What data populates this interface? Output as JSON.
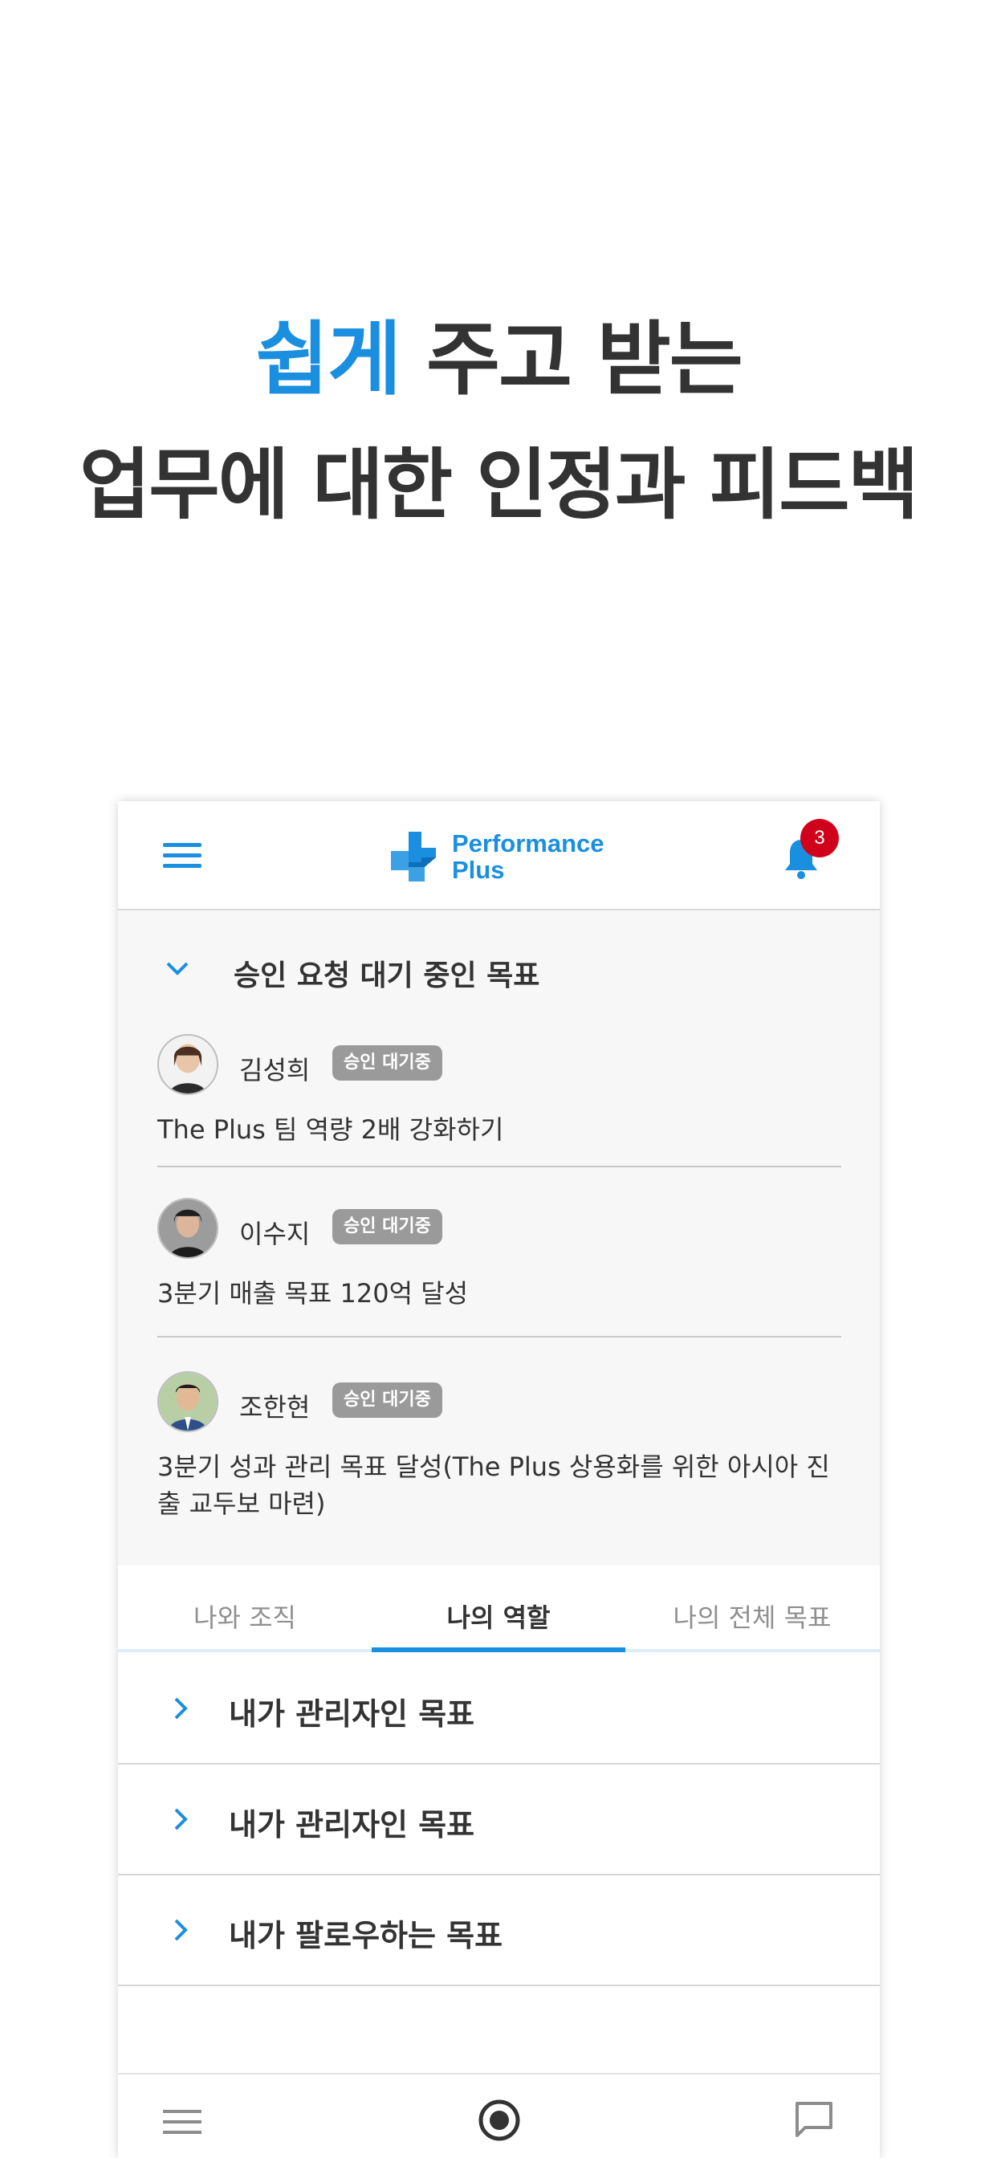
{
  "headline": {
    "line1_accent": "쉽게",
    "line1_rest": " 주고 받는",
    "line2": "업무에 대한 인정과 피드백"
  },
  "colors": {
    "accent": "#1a8fe0",
    "text": "#333333",
    "badge": "#d0021b",
    "status_chip": "#9a9a9a"
  },
  "app": {
    "logo_line1": "Performance",
    "logo_line2": "Plus",
    "notification_count": "3",
    "icons": {
      "menu": "hamburger-menu-icon",
      "notifications": "bell-icon"
    }
  },
  "pending": {
    "title": "승인 요청 대기 중인 목표",
    "requests": [
      {
        "name": "김성희",
        "status": "승인 대기중",
        "goal": "The Plus 팀 역량 2배 강화하기"
      },
      {
        "name": "이수지",
        "status": "승인 대기중",
        "goal": "3분기 매출 목표 120억 달성"
      },
      {
        "name": "조한현",
        "status": "승인 대기중",
        "goal": "3분기 성과 관리 목표 달성(The Plus 상용화를 위한 아시아 진출 교두보 마련)"
      }
    ]
  },
  "tabs": [
    {
      "label": "나와 조직"
    },
    {
      "label": "나의 역할",
      "active": true
    },
    {
      "label": "나의 전체 목표"
    }
  ],
  "sections": [
    {
      "label": "내가 관리자인 목표"
    },
    {
      "label": "내가 관리자인 목표"
    },
    {
      "label": "내가 팔로우하는 목표"
    }
  ],
  "bottom_nav": {
    "icons": [
      "menu-icon",
      "home-target-icon",
      "chat-icon"
    ]
  }
}
